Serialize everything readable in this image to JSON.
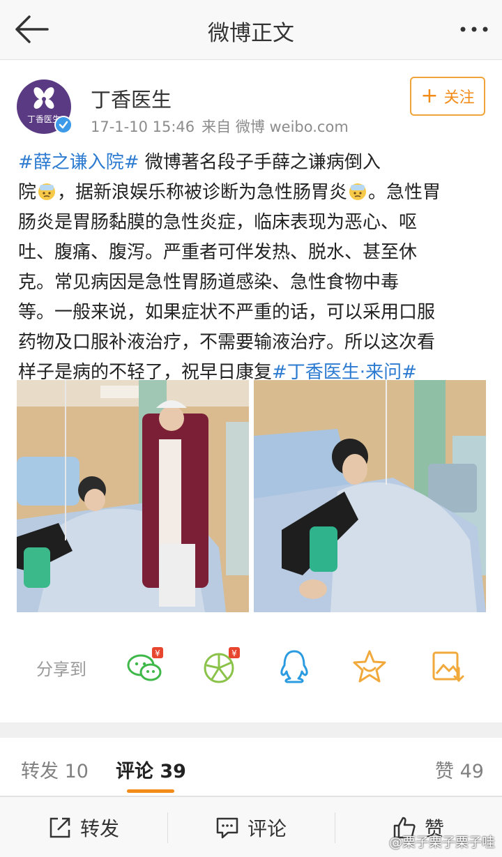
{
  "nav": {
    "title": "微博正文"
  },
  "author": {
    "name": "丁香医生",
    "avatar_text": "丁香医生",
    "time": "17-1-10 15:46",
    "source": "来自 微博 weibo.com"
  },
  "follow_label": "关注",
  "post": {
    "lines": [
      [
        {
          "t": "tag",
          "v": "#薛之谦入院#"
        },
        {
          "t": "text",
          "v": " 微博著名段子手薛之谦病倒入"
        }
      ],
      [
        {
          "t": "text",
          "v": "院"
        },
        {
          "t": "emo"
        },
        {
          "t": "text",
          "v": "，据新浪娱乐称被诊断为急性肠胃炎"
        },
        {
          "t": "emo"
        },
        {
          "t": "text",
          "v": "。急性胃"
        }
      ],
      [
        {
          "t": "text",
          "v": "肠炎是胃肠黏膜的急性炎症，临床表现为恶心、呕"
        }
      ],
      [
        {
          "t": "text",
          "v": "吐、腹痛、腹泻。严重者可伴发热、脱水、甚至休"
        }
      ],
      [
        {
          "t": "text",
          "v": "克。常见病因是急性胃肠道感染、急性食物中毒"
        }
      ],
      [
        {
          "t": "text",
          "v": "等。一般来说，如果症状不严重的话，可以采用口服"
        }
      ],
      [
        {
          "t": "text",
          "v": "药物及口服补液治疗，不需要输液治疗。所以这次看"
        }
      ],
      [
        {
          "t": "text",
          "v": "样子是病的不轻了，祝早日康复"
        },
        {
          "t": "tag",
          "v": "#丁香医生·来问#"
        }
      ]
    ]
  },
  "share": {
    "label": "分享到",
    "icons": [
      "wechat-icon",
      "moments-icon",
      "qq-icon",
      "favorite-star-icon",
      "save-image-icon"
    ],
    "badge": "¥"
  },
  "tabs": {
    "repost": "转发 10",
    "comment": "评论 39",
    "like": "赞 49"
  },
  "actions": {
    "repost": "转发",
    "comment": "评论",
    "like": "赞"
  },
  "watermark": "@栗子栗子栗子哇",
  "colors": {
    "accent": "#f28b18",
    "link": "#2c7bd1",
    "verified": "#3d9ae8",
    "avatar_bg": "#5b3a84"
  }
}
